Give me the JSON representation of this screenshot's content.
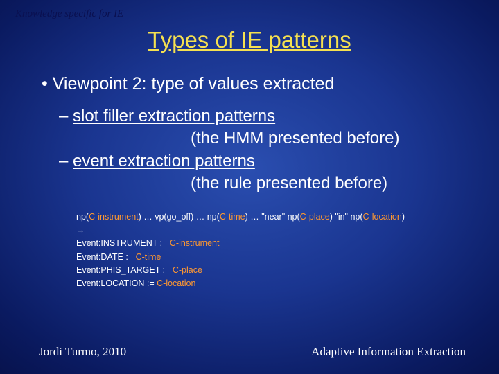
{
  "breadcrumb": "Knowledge specific for IE",
  "title": "Types of IE patterns",
  "main_bullet": "Viewpoint 2: type of values extracted",
  "sub1_label": "slot filler extraction patterns",
  "sub1_detail": "(the HMM presented before)",
  "sub2_label": "event extraction patterns",
  "sub2_detail": "(the rule presented before)",
  "rule": {
    "l1_a": "np(",
    "l1_b": "C-instrument",
    "l1_c": ") … vp(go_off) … np(",
    "l1_d": "C-time",
    "l1_e": ") … \"near\" np(",
    "l1_f": "C-place",
    "l1_g": ") \"in\" np(",
    "l1_h": "C-location",
    "l1_i": ")",
    "l2": "→",
    "l3_a": "Event:INSTRUMENT := ",
    "l3_b": "C-instrument",
    "l4_a": "Event:DATE := ",
    "l4_b": "C-time",
    "l5_a": "Event:PHIS_TARGET := ",
    "l5_b": "C-place",
    "l6_a": "Event:LOCATION := ",
    "l6_b": "C-location"
  },
  "footer_left": "Jordi Turmo, 2010",
  "footer_right": "Adaptive Information Extraction"
}
